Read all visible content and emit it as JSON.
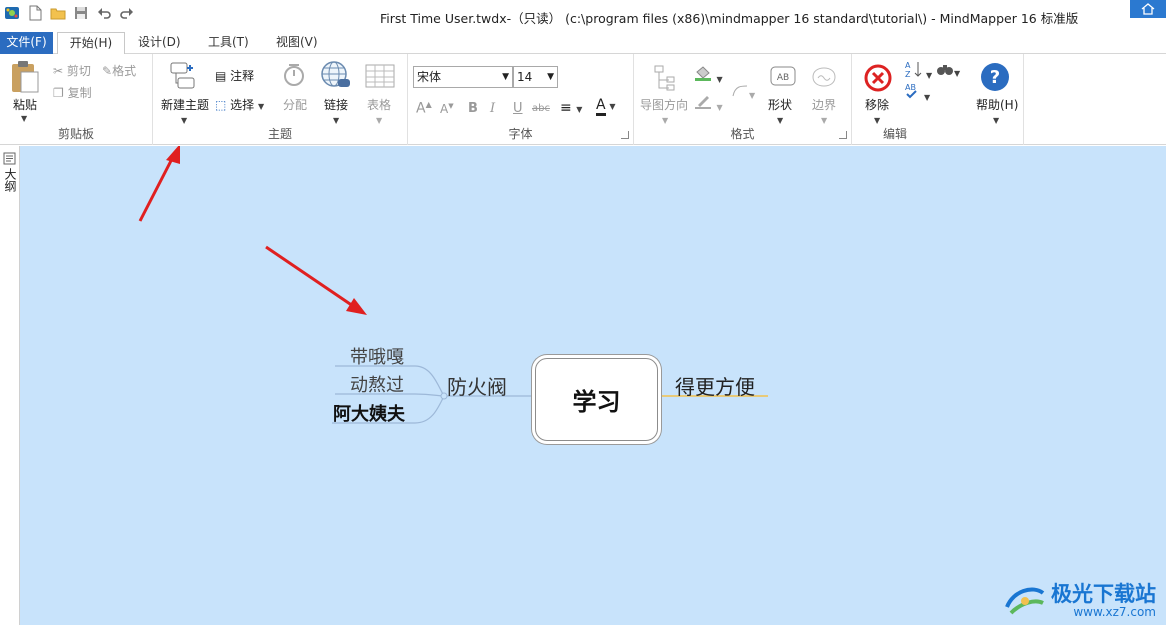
{
  "window": {
    "title": "First Time User.twdx-（只读） (c:\\program files (x86)\\mindmapper 16 standard\\tutorial\\) - MindMapper 16 标准版"
  },
  "menu": {
    "file": "文件(F)",
    "tabs": [
      "开始(H)",
      "设计(D)",
      "工具(T)",
      "视图(V)"
    ]
  },
  "ribbon": {
    "clipboard": {
      "paste": "粘贴",
      "cut": "剪切",
      "format": "格式",
      "copy": "复制",
      "label": "剪贴板"
    },
    "topic": {
      "new_topic": "新建主题",
      "note": "注释",
      "select": "选择",
      "distribute": "分配",
      "link": "链接",
      "table": "表格",
      "label": "主题"
    },
    "font": {
      "font_name": "宋体",
      "font_size": "14",
      "label": "字体",
      "bold": "B",
      "italic": "I",
      "underline": "U",
      "strike": "abc"
    },
    "format": {
      "map_direction": "导图方向",
      "shape": "形状",
      "border": "边界",
      "label": "格式"
    },
    "edit": {
      "remove": "移除",
      "label": "编辑"
    },
    "help": {
      "help": "帮助(H)"
    }
  },
  "sidepanel": {
    "outline": "大纲"
  },
  "mindmap": {
    "central": "学习",
    "right_topic": "得更方便",
    "left_topic": "防火阀",
    "subtopics": [
      "带哦嘎",
      "动熬过",
      "阿大姨夫"
    ]
  },
  "watermark": {
    "name": "极光下载站",
    "url": "www.xz7.com"
  },
  "colors": {
    "canvas": "#c8e3fb",
    "accent": "#2b6cc0",
    "arrow": "#e02020"
  }
}
